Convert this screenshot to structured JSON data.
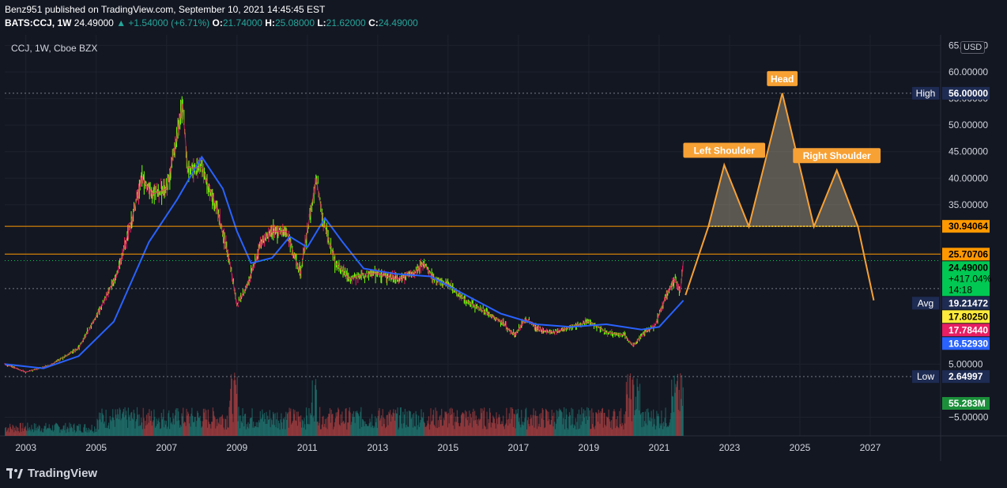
{
  "header": {
    "line1": "Benz951 published on TradingView.com, September 10, 2021 14:45:45 EST",
    "ticker": "BATS:CCJ, 1W",
    "price": "24.49000",
    "change": "▲ +1.54000 (+6.71%)",
    "o_label": "O:",
    "o_val": "21.74000",
    "h_label": "H:",
    "h_val": "25.08000",
    "l_label": "L:",
    "l_val": "21.62000",
    "c_label": "C:",
    "c_val": "24.49000"
  },
  "chart_title": "CCJ, 1W, Cboe BZX",
  "currency": "USD",
  "footer": {
    "brand": "TradingView"
  },
  "colors": {
    "background": "#131722",
    "ma_line": "#2962ff",
    "pattern": "#f7a134",
    "hline": "#ff9800",
    "candle_a": "#e91e63",
    "candle_b": "#76ff03",
    "up_volume": "#26a69a",
    "down_volume": "#ef5350"
  },
  "chart_data": {
    "type": "candlestick",
    "timeframe": "1W",
    "x_range": [
      2002.4,
      2029.0
    ],
    "y_range": [
      -8.5,
      67
    ],
    "x_ticks": [
      "2003",
      "2005",
      "2007",
      "2009",
      "2011",
      "2013",
      "2015",
      "2017",
      "2019",
      "2021",
      "2023",
      "2025",
      "2027"
    ],
    "y_ticks": [
      "65.00000",
      "60.00000",
      "55.00000",
      "50.00000",
      "45.00000",
      "40.00000",
      "35.00000",
      "5.00000",
      "−5.00000"
    ],
    "y_tick_values": [
      65,
      60,
      55,
      50,
      45,
      40,
      35,
      5,
      -5
    ],
    "price_path": [
      [
        2002.4,
        5.0
      ],
      [
        2003.0,
        3.5
      ],
      [
        2003.7,
        4.8
      ],
      [
        2004.5,
        8.0
      ],
      [
        2005.0,
        14.0
      ],
      [
        2005.6,
        22.0
      ],
      [
        2006.0,
        32.0
      ],
      [
        2006.3,
        40.0
      ],
      [
        2006.6,
        37.0
      ],
      [
        2007.0,
        38.0
      ],
      [
        2007.3,
        48.0
      ],
      [
        2007.45,
        54.0
      ],
      [
        2007.6,
        42.0
      ],
      [
        2008.0,
        42.0
      ],
      [
        2008.4,
        35.0
      ],
      [
        2008.8,
        24.0
      ],
      [
        2009.0,
        16.0
      ],
      [
        2009.3,
        20.0
      ],
      [
        2009.7,
        28.0
      ],
      [
        2010.0,
        30.0
      ],
      [
        2010.4,
        30.0
      ],
      [
        2010.8,
        22.0
      ],
      [
        2011.0,
        30.0
      ],
      [
        2011.25,
        40.0
      ],
      [
        2011.45,
        32.0
      ],
      [
        2011.8,
        24.0
      ],
      [
        2012.2,
        21.0
      ],
      [
        2012.6,
        22.0
      ],
      [
        2013.0,
        22.0
      ],
      [
        2013.5,
        21.0
      ],
      [
        2014.0,
        22.0
      ],
      [
        2014.3,
        24.0
      ],
      [
        2014.6,
        21.0
      ],
      [
        2015.0,
        20.0
      ],
      [
        2015.5,
        17.0
      ],
      [
        2016.0,
        15.0
      ],
      [
        2016.5,
        13.0
      ],
      [
        2016.9,
        10.5
      ],
      [
        2017.2,
        13.5
      ],
      [
        2017.6,
        11.5
      ],
      [
        2018.0,
        11.0
      ],
      [
        2018.5,
        12.0
      ],
      [
        2019.0,
        13.0
      ],
      [
        2019.5,
        11.0
      ],
      [
        2020.0,
        10.5
      ],
      [
        2020.25,
        8.5
      ],
      [
        2020.6,
        11.0
      ],
      [
        2020.9,
        12.5
      ],
      [
        2021.2,
        18.0
      ],
      [
        2021.45,
        21.0
      ],
      [
        2021.6,
        18.5
      ],
      [
        2021.69,
        24.49
      ]
    ],
    "moving_average": [
      [
        2002.4,
        5.0
      ],
      [
        2003.5,
        4.2
      ],
      [
        2004.5,
        6.5
      ],
      [
        2005.5,
        13.0
      ],
      [
        2006.5,
        28.0
      ],
      [
        2007.3,
        36.0
      ],
      [
        2008.0,
        44.0
      ],
      [
        2008.6,
        38.0
      ],
      [
        2009.0,
        30.0
      ],
      [
        2009.4,
        24.0
      ],
      [
        2010.0,
        25.0
      ],
      [
        2010.5,
        29.0
      ],
      [
        2011.0,
        27.0
      ],
      [
        2011.5,
        32.5
      ],
      [
        2012.0,
        28.0
      ],
      [
        2012.6,
        23.0
      ],
      [
        2013.5,
        22.0
      ],
      [
        2014.5,
        21.5
      ],
      [
        2015.5,
        18.0
      ],
      [
        2016.5,
        14.5
      ],
      [
        2017.5,
        12.5
      ],
      [
        2018.5,
        12.0
      ],
      [
        2019.5,
        12.5
      ],
      [
        2020.5,
        11.5
      ],
      [
        2021.0,
        12.0
      ],
      [
        2021.69,
        17.0
      ]
    ],
    "projection": [
      [
        2021.75,
        18.0
      ],
      [
        2022.4,
        30.9
      ],
      [
        2022.85,
        42.5
      ],
      [
        2023.55,
        30.9
      ],
      [
        2024.5,
        56.0
      ],
      [
        2025.4,
        30.9
      ],
      [
        2026.05,
        41.5
      ],
      [
        2026.65,
        30.9
      ],
      [
        2027.1,
        17.0
      ]
    ],
    "neckline": {
      "value": 30.94064,
      "from": 2022.4,
      "to": 2026.65
    },
    "pattern_labels": [
      {
        "text": "Left Shoulder",
        "x": 2022.85
      },
      {
        "text": "Head",
        "x": 2024.5
      },
      {
        "text": "Right Shoulder",
        "x": 2026.05
      }
    ],
    "horizontal_lines": [
      {
        "value": 30.94064,
        "label": "30.94064",
        "style": "solid"
      },
      {
        "value": 25.70706,
        "label": "25.70706",
        "style": "solid"
      },
      {
        "value": 56.0,
        "label": "56.00000",
        "style": "dotted",
        "tag": "High"
      },
      {
        "value": 19.21472,
        "label": "19.21472",
        "style": "dotted",
        "tag": "Avg"
      },
      {
        "value": 2.64997,
        "label": "2.64997",
        "style": "dotted",
        "tag": "Low"
      },
      {
        "value": 24.49,
        "label": "24.49000",
        "style": "dotted-green"
      }
    ],
    "price_labels": [
      {
        "value": 56.0,
        "text": "56.00000",
        "tag": "High",
        "color": "#1e2b52",
        "fg": "#ffffff"
      },
      {
        "value": 30.94064,
        "text": "30.94064",
        "color": "#ff9800",
        "fg": "#000000"
      },
      {
        "value": 25.70706,
        "text": "25.70706",
        "color": "#ff9800",
        "fg": "#000000"
      },
      {
        "value": 24.49,
        "text": "24.49000",
        "text2": "+417.04%",
        "text3": "14:18",
        "color": "#00c853",
        "fg": "#000000"
      },
      {
        "value": 19.21472,
        "text": "19.21472",
        "tag": "Avg",
        "color": "#1e2b52",
        "fg": "#ffffff"
      },
      {
        "value": 17.8025,
        "text": "17.80250",
        "color": "#ffeb3b",
        "fg": "#000000"
      },
      {
        "value": 17.7844,
        "text": "17.78440",
        "color": "#e91e63",
        "fg": "#ffffff"
      },
      {
        "value": 16.5293,
        "text": "16.52930",
        "color": "#2962ff",
        "fg": "#ffffff"
      },
      {
        "value": 2.64997,
        "text": "2.64997",
        "tag": "Low",
        "color": "#1e2b52",
        "fg": "#ffffff"
      },
      {
        "value": 0,
        "text": "55.283M",
        "color": "#1b8f3a",
        "fg": "#ffffff"
      }
    ]
  }
}
